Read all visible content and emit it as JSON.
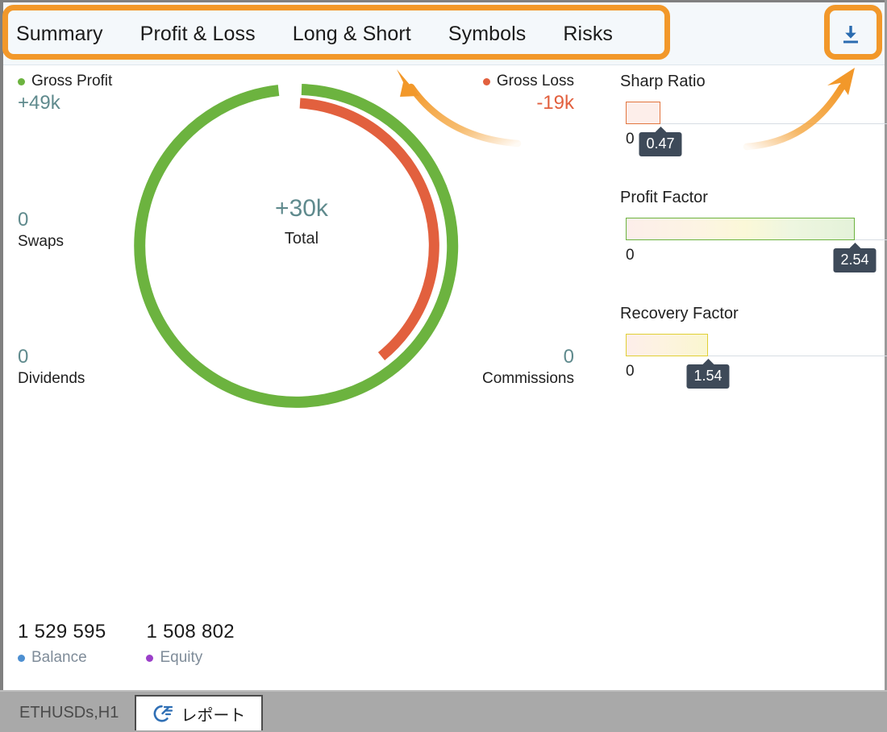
{
  "header": {
    "tabs": [
      {
        "label": "Summary",
        "active": true
      },
      {
        "label": "Profit & Loss",
        "active": false
      },
      {
        "label": "Long & Short",
        "active": false
      },
      {
        "label": "Symbols",
        "active": false
      },
      {
        "label": "Risks",
        "active": false
      }
    ],
    "download_button": {
      "icon": "download-icon",
      "color": "#2b6cb0"
    }
  },
  "colors": {
    "accent_orange": "#f2982a",
    "green": "#6cb33f",
    "red": "#e2603e",
    "teal_text": "#5f8a8d",
    "balance_dot": "#4d8fd1",
    "equity_dot": "#9b3fc9",
    "tooltip_bg": "#3e4a59"
  },
  "chart_data": {
    "type": "pie",
    "title": "Total",
    "center_value": "+30k",
    "center_label": "Total",
    "series": [
      {
        "name": "Gross Profit",
        "label": "+49k",
        "value": 49,
        "color": "#6cb33f",
        "ring": "outer",
        "sweep_deg": 345
      },
      {
        "name": "Gross Loss",
        "label": "-19k",
        "value": -19,
        "color": "#e2603e",
        "ring": "inner",
        "sweep_deg": 140
      }
    ],
    "legend_position": "corners"
  },
  "summary": {
    "gross_profit": {
      "legend": "Gross Profit",
      "value": "+49k",
      "dot_color": "#6cb33f"
    },
    "gross_loss": {
      "legend": "Gross Loss",
      "value": "-19k",
      "dot_color": "#e2603e"
    },
    "swaps": {
      "value": "0",
      "label": "Swaps"
    },
    "dividends": {
      "value": "0",
      "label": "Dividends"
    },
    "commissions": {
      "value": "0",
      "label": "Commissions"
    }
  },
  "metrics": [
    {
      "title": "Sharp Ratio",
      "zero_label": "0",
      "value": "0.47",
      "fill_pct": 13,
      "gradient": "linear-gradient(to right, #fdeeea, #fdeeea)",
      "border_color": "#e2753f"
    },
    {
      "title": "Profit Factor",
      "zero_label": "0",
      "value": "2.54",
      "fill_pct": 86,
      "gradient": "linear-gradient(to right, #fdeeea 0%, #fdf4e3 32%, #fbf8d8 52%, #eef6e0 72%, #e4f2d9 100%)",
      "border_color": "#6cb33f"
    },
    {
      "title": "Recovery Factor",
      "zero_label": "0",
      "value": "1.54",
      "fill_pct": 31,
      "gradient": "linear-gradient(to right, #fdeeea 0%, #fdf3e0 45%, #faf6cf 100%)",
      "border_color": "#e0cf35"
    }
  ],
  "footer": {
    "balance": {
      "value": "1 529 595",
      "label": "Balance",
      "dot_color": "#4d8fd1"
    },
    "equity": {
      "value": "1 508 802",
      "label": "Equity",
      "dot_color": "#9b3fc9"
    }
  },
  "bottom_tabs": [
    {
      "label": "ETHUSDs,H1",
      "active": false,
      "icon": null
    },
    {
      "label": "レポート",
      "active": true,
      "icon": "report-icon"
    }
  ]
}
